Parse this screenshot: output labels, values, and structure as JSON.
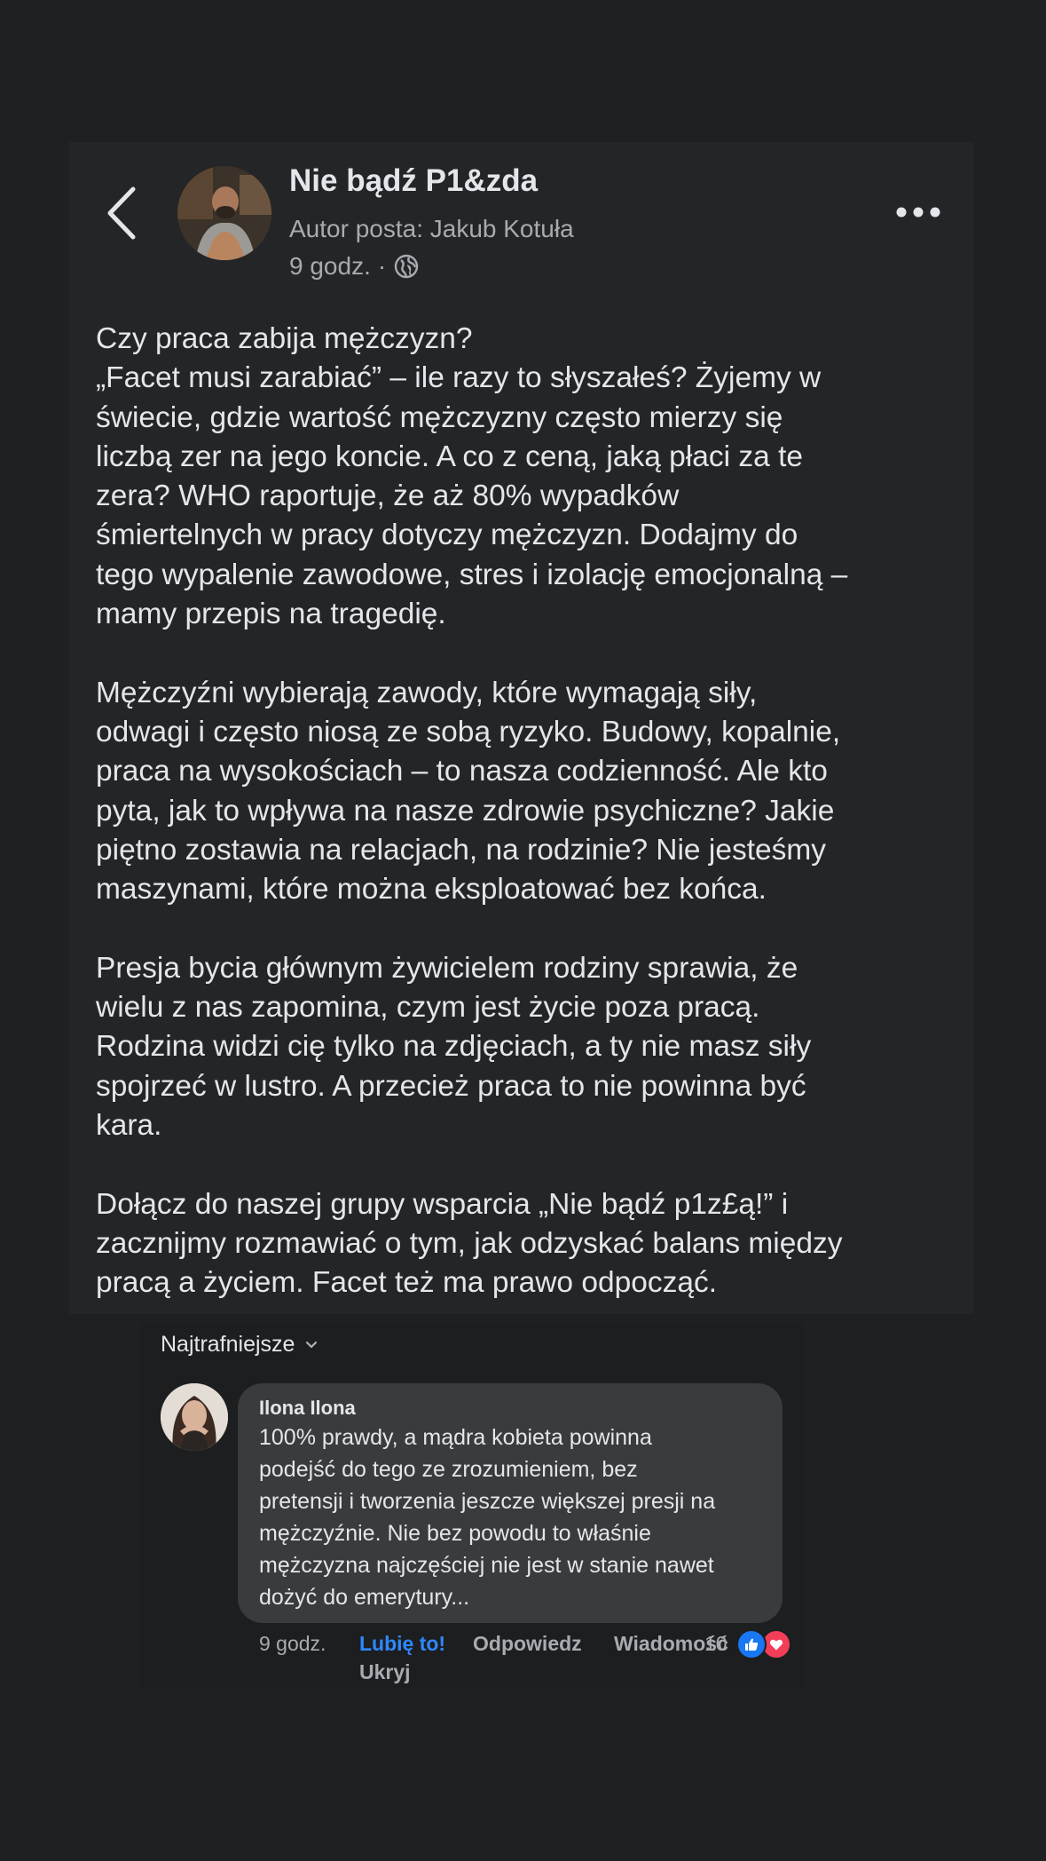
{
  "header": {
    "group_name": "Nie bądź P1&zda",
    "author": "Autor posta: Jakub Kotuła",
    "time": "9 godz.",
    "separator": "·",
    "back_icon": "chevron-left-icon",
    "more_icon": "more-horizontal-icon",
    "privacy_icon": "globe-icon"
  },
  "post": {
    "paragraphs": [
      [
        "Czy praca zabija mężczyzn?",
        "„Facet musi zarabiać” – ile razy to słyszałeś? Żyjemy w",
        "świecie, gdzie wartość mężczyzny często mierzy się",
        "liczbą zer na jego koncie. A co z ceną, jaką płaci za te",
        "zera? WHO raportuje, że aż 80% wypadków",
        "śmiertelnych w pracy dotyczy mężczyzn. Dodajmy do",
        "tego wypalenie zawodowe, stres i izolację emocjonalną –",
        "mamy przepis na tragedię."
      ],
      [
        "Mężczyźni wybierają zawody, które wymagają siły,",
        "odwagi i często niosą ze sobą ryzyko. Budowy, kopalnie,",
        "praca na wysokościach – to nasza codzienność. Ale kto",
        "pyta, jak to wpływa na nasze zdrowie psychiczne? Jakie",
        "piętno zostawia na relacjach, na rodzinie? Nie jesteśmy",
        "maszynami, które można eksploatować bez końca."
      ],
      [
        "Presja bycia głównym żywicielem rodziny sprawia, że",
        "wielu z nas zapomina, czym jest życie poza pracą.",
        "Rodzina widzi cię tylko na zdjęciach, a ty nie masz siły",
        "spojrzeć w lustro. A przecież praca to nie powinna być",
        "kara."
      ],
      [
        "Dołącz do naszej grupy wsparcia „Nie bądź p1z£ą!” i",
        "zacznijmy rozmawiać o tym, jak odzyskać balans między",
        "pracą a życiem. Facet też ma prawo odpocząć."
      ]
    ]
  },
  "comments": {
    "sort_label": "Najtrafniejsze",
    "items": [
      {
        "author": "Ilona Ilona",
        "lines": [
          "100% prawdy, a mądra kobieta powinna",
          "podejść do tego ze zrozumieniem, bez",
          "pretensji i tworzenia jeszcze większej presji na",
          "mężczyźnie. Nie bez powodu to właśnie",
          "mężczyzna najczęściej nie jest w stanie nawet",
          "dożyć do emerytury..."
        ],
        "time": "9 godz.",
        "like_label": "Lubię to!",
        "reply_label": "Odpowiedz",
        "message_label": "Wiadomość",
        "hide_label": "Ukryj",
        "reaction_count": "10",
        "reactions": [
          "like-icon",
          "heart-icon"
        ]
      }
    ]
  },
  "colors": {
    "background": "#1f2022",
    "card": "#242527",
    "bubble": "#3a3b3d",
    "text": "#e4e6eb",
    "secondary_text": "#a8abb0",
    "link_blue": "#2d88ff",
    "like_blue": "#1877f2",
    "heart_red": "#f33e58"
  }
}
